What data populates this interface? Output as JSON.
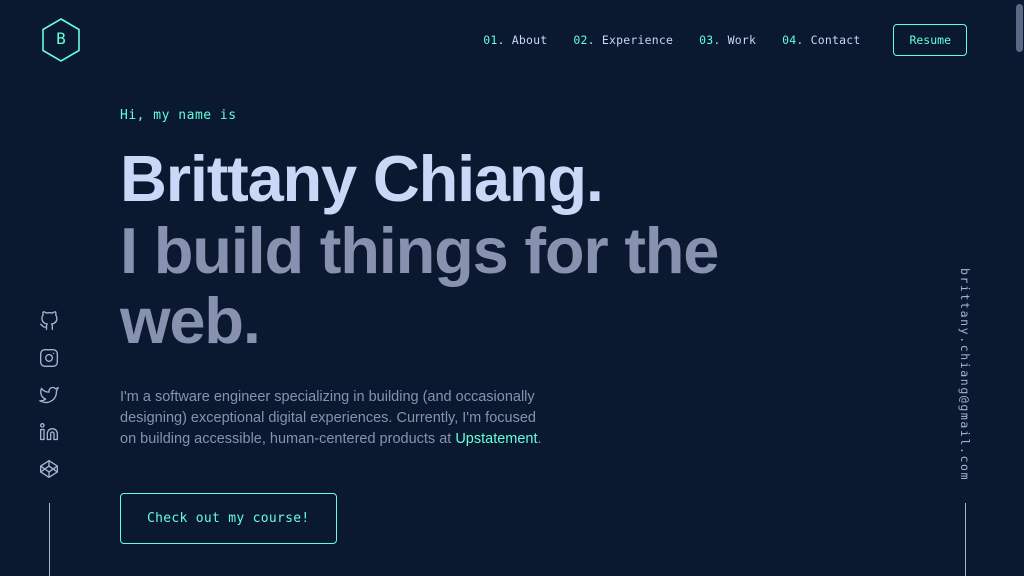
{
  "theme": {
    "background": "#0a192f",
    "accent": "#64ffda",
    "heading": "#ccd6f6",
    "muted": "#8892b0",
    "slate": "#a8b2d1",
    "scrollbar": "#5a6785"
  },
  "header": {
    "logo_letter": "B",
    "nav": [
      {
        "num": "01.",
        "label": " About"
      },
      {
        "num": "02.",
        "label": " Experience"
      },
      {
        "num": "03.",
        "label": " Work"
      },
      {
        "num": "04.",
        "label": " Contact"
      }
    ],
    "resume_label": "Resume"
  },
  "hero": {
    "greeting": "Hi, my name is",
    "title": "Brittany Chiang.",
    "subtitle": "I build things for the web.",
    "description_part1": "I'm a software engineer specializing in building (and occasionally designing) exceptional digital experiences. Currently, I'm focused on building accessible, human-centered products at ",
    "description_link": "Upstatement",
    "description_part2": ".",
    "cta_label": "Check out my course!"
  },
  "social": {
    "items": [
      {
        "name": "github",
        "icon": "github-icon"
      },
      {
        "name": "instagram",
        "icon": "instagram-icon"
      },
      {
        "name": "twitter",
        "icon": "twitter-icon"
      },
      {
        "name": "linkedin",
        "icon": "linkedin-icon"
      },
      {
        "name": "codepen",
        "icon": "codepen-icon"
      }
    ]
  },
  "email": {
    "address": "brittany.chiang@gmail.com"
  }
}
